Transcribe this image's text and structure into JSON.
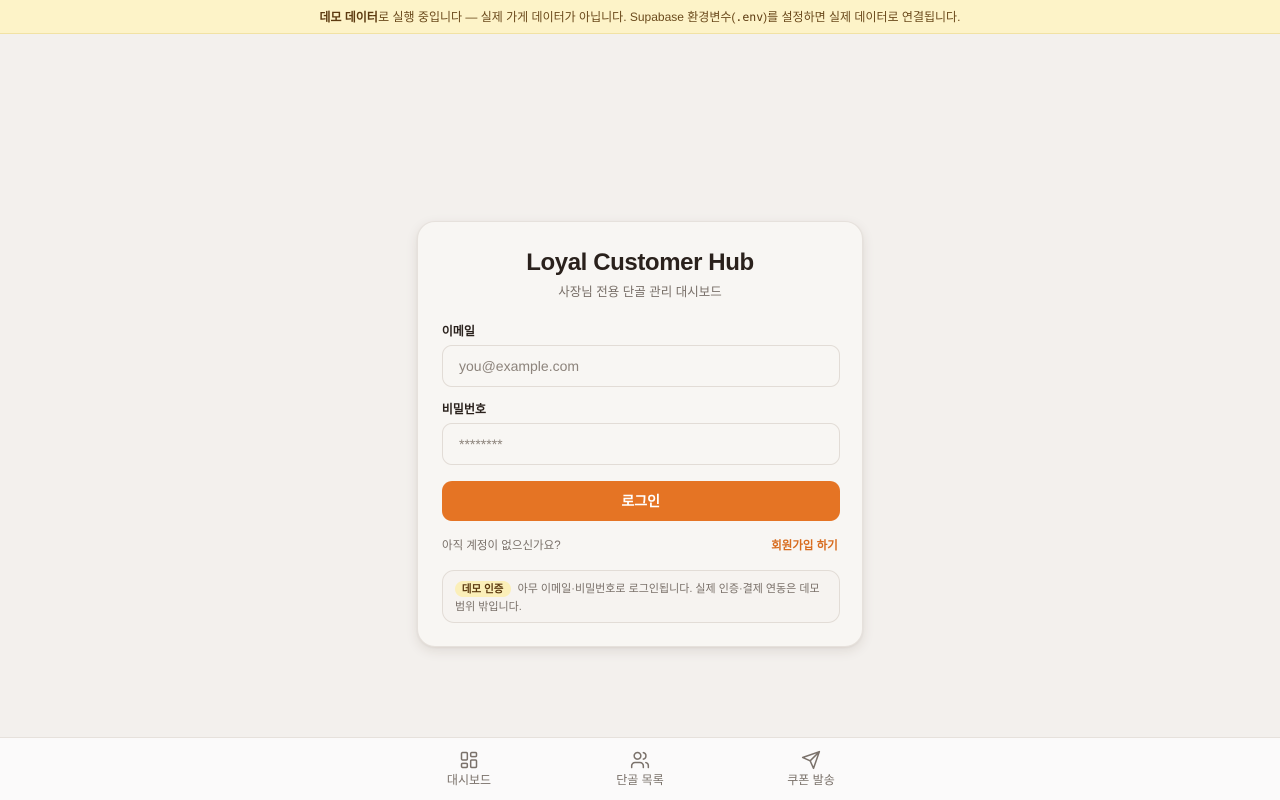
{
  "banner": {
    "strong": "데모 데이터",
    "text_before_code": "로 실행 중입니다 — 실제 가게 데이터가 아닙니다. Supabase 환경변수(",
    "code": ".env",
    "text_after_code": ")를 설정하면 실제 데이터로 연결됩니다."
  },
  "login": {
    "title": "Loyal Customer Hub",
    "subtitle": "사장님 전용 단골 관리 대시보드",
    "email_label": "이메일",
    "email_placeholder": "you@example.com",
    "email_value": "",
    "password_label": "비밀번호",
    "password_placeholder": "********",
    "password_value": "",
    "submit_label": "로그인",
    "signup_question": "아직 계정이 없으신가요?",
    "signup_link": "회원가입 하기",
    "demo_badge": "데모 인증",
    "demo_notice": "아무 이메일·비밀번호로 로그인됩니다. 실제 인증·결제 연동은 데모 범위 밖입니다."
  },
  "bottom_nav": {
    "items": [
      {
        "label": "대시보드",
        "icon": "dashboard-grid-icon"
      },
      {
        "label": "단골 목록",
        "icon": "users-icon"
      },
      {
        "label": "쿠폰 발송",
        "icon": "send-icon"
      }
    ]
  },
  "colors": {
    "accent": "#e57424",
    "banner_bg": "#fdf3c8",
    "page_bg": "#f3f0ed",
    "card_bg": "#f8f6f3"
  }
}
